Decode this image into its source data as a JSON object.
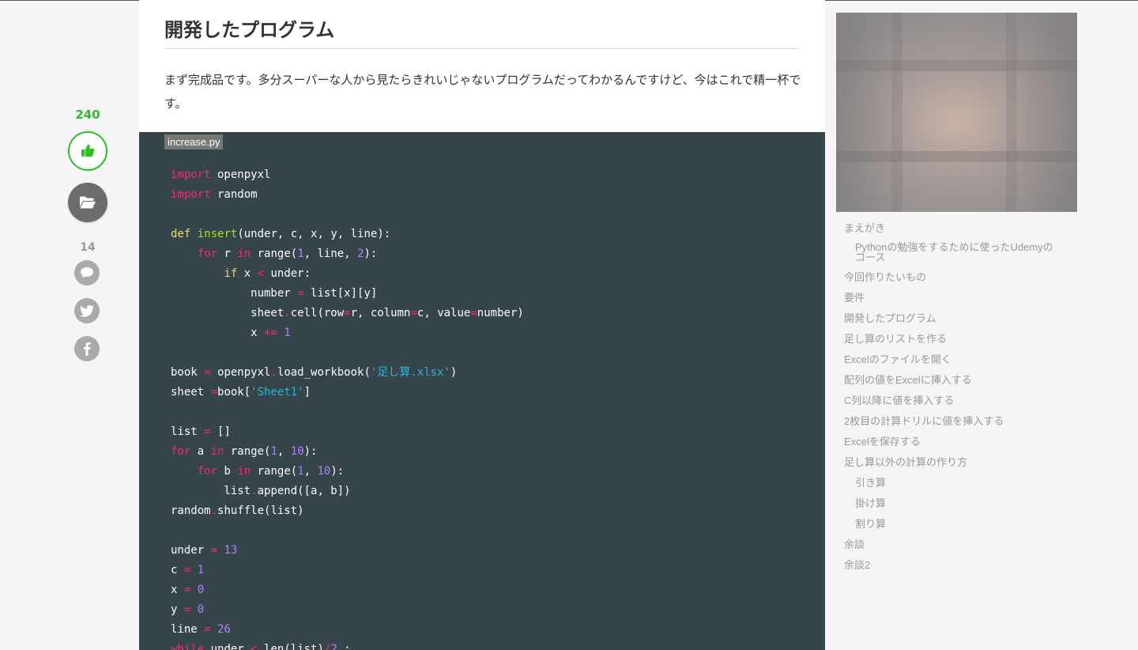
{
  "rail": {
    "like_count": "240",
    "comment_count": "14"
  },
  "icons": {
    "like": "thumbs-up-icon",
    "stock": "folder-open-icon",
    "comment": "speech-bubble-icon",
    "twitter": "twitter-bird-icon",
    "facebook": "facebook-f-icon"
  },
  "colors": {
    "like_green": "#2bc120",
    "code_background": "#364549",
    "keyword": "#f92672",
    "def_keyword": "#e6db74",
    "function_name": "#a6e22e",
    "number": "#ae81ff",
    "string": "#2bb3d4",
    "toc_text": "#999999"
  },
  "article": {
    "heading": "開発したプログラム",
    "paragraph": "まず完成品です。多分スーパーな人から見たらきれいじゃないプログラムだってわかるんですけど、今はこれで精一杯です。",
    "code_filename": "increase.py",
    "code_lines": [
      [
        [
          "kw",
          "import"
        ],
        [
          "txt",
          " openpyxl"
        ]
      ],
      [
        [
          "kw",
          "import"
        ],
        [
          "txt",
          " random"
        ]
      ],
      [],
      [
        [
          "def",
          "def"
        ],
        [
          "txt",
          " "
        ],
        [
          "fn",
          "insert"
        ],
        [
          "txt",
          "(under, c, x, y, line):"
        ]
      ],
      [
        [
          "txt",
          "    "
        ],
        [
          "kw",
          "for"
        ],
        [
          "txt",
          " r "
        ],
        [
          "kw",
          "in"
        ],
        [
          "txt",
          " range("
        ],
        [
          "num",
          "1"
        ],
        [
          "txt",
          ", line, "
        ],
        [
          "num",
          "2"
        ],
        [
          "txt",
          "):"
        ]
      ],
      [
        [
          "txt",
          "        "
        ],
        [
          "def",
          "if"
        ],
        [
          "txt",
          " x "
        ],
        [
          "op",
          "<"
        ],
        [
          "txt",
          " under:"
        ]
      ],
      [
        [
          "txt",
          "            number "
        ],
        [
          "op",
          "="
        ],
        [
          "txt",
          " list[x][y]"
        ]
      ],
      [
        [
          "txt",
          "            sheet"
        ],
        [
          "op",
          "."
        ],
        [
          "txt",
          "cell(row"
        ],
        [
          "op",
          "="
        ],
        [
          "txt",
          "r, column"
        ],
        [
          "op",
          "="
        ],
        [
          "txt",
          "c, value"
        ],
        [
          "op",
          "="
        ],
        [
          "txt",
          "number)"
        ]
      ],
      [
        [
          "txt",
          "            x "
        ],
        [
          "op",
          "+="
        ],
        [
          "txt",
          " "
        ],
        [
          "num",
          "1"
        ]
      ],
      [],
      [
        [
          "txt",
          "book "
        ],
        [
          "op",
          "="
        ],
        [
          "txt",
          " openpyxl"
        ],
        [
          "op",
          "."
        ],
        [
          "txt",
          "load_workbook("
        ],
        [
          "str",
          "'足し算.xlsx'"
        ],
        [
          "txt",
          ")"
        ]
      ],
      [
        [
          "txt",
          "sheet "
        ],
        [
          "op",
          "="
        ],
        [
          "txt",
          "book["
        ],
        [
          "str",
          "'Sheet1'"
        ],
        [
          "txt",
          "]"
        ]
      ],
      [],
      [
        [
          "txt",
          "list "
        ],
        [
          "op",
          "="
        ],
        [
          "txt",
          " []"
        ]
      ],
      [
        [
          "kw",
          "for"
        ],
        [
          "txt",
          " a "
        ],
        [
          "kw",
          "in"
        ],
        [
          "txt",
          " range("
        ],
        [
          "num",
          "1"
        ],
        [
          "txt",
          ", "
        ],
        [
          "num",
          "10"
        ],
        [
          "txt",
          "):"
        ]
      ],
      [
        [
          "txt",
          "    "
        ],
        [
          "kw",
          "for"
        ],
        [
          "txt",
          " b "
        ],
        [
          "kw",
          "in"
        ],
        [
          "txt",
          " range("
        ],
        [
          "num",
          "1"
        ],
        [
          "txt",
          ", "
        ],
        [
          "num",
          "10"
        ],
        [
          "txt",
          "):"
        ]
      ],
      [
        [
          "txt",
          "        list"
        ],
        [
          "op",
          "."
        ],
        [
          "txt",
          "append([a, b])"
        ]
      ],
      [
        [
          "txt",
          "random"
        ],
        [
          "op",
          "."
        ],
        [
          "txt",
          "shuffle(list)"
        ]
      ],
      [],
      [
        [
          "txt",
          "under "
        ],
        [
          "op",
          "="
        ],
        [
          "txt",
          " "
        ],
        [
          "num",
          "13"
        ]
      ],
      [
        [
          "txt",
          "c "
        ],
        [
          "op",
          "="
        ],
        [
          "txt",
          " "
        ],
        [
          "num",
          "1"
        ]
      ],
      [
        [
          "txt",
          "x "
        ],
        [
          "op",
          "="
        ],
        [
          "txt",
          " "
        ],
        [
          "num",
          "0"
        ]
      ],
      [
        [
          "txt",
          "y "
        ],
        [
          "op",
          "="
        ],
        [
          "txt",
          " "
        ],
        [
          "num",
          "0"
        ]
      ],
      [
        [
          "txt",
          "line "
        ],
        [
          "op",
          "="
        ],
        [
          "txt",
          " "
        ],
        [
          "num",
          "26"
        ]
      ],
      [
        [
          "kw",
          "while"
        ],
        [
          "txt",
          " under "
        ],
        [
          "op",
          "<"
        ],
        [
          "txt",
          " len(list)"
        ],
        [
          "op",
          "/"
        ],
        [
          "num",
          "2"
        ],
        [
          "txt",
          " :"
        ]
      ]
    ]
  },
  "sidebar": {
    "toc": [
      {
        "label": "まえがき",
        "level": 1
      },
      {
        "label": "Pythonの勉強をするために使ったUdemyのコース",
        "level": 2
      },
      {
        "label": "今回作りたいもの",
        "level": 1
      },
      {
        "label": "要件",
        "level": 1
      },
      {
        "label": "開発したプログラム",
        "level": 1
      },
      {
        "label": "足し算のリストを作る",
        "level": 1
      },
      {
        "label": "Excelのファイルを開く",
        "level": 1
      },
      {
        "label": "配列の値をExcelに挿入する",
        "level": 1
      },
      {
        "label": "C列以降に値を挿入する",
        "level": 1
      },
      {
        "label": "2枚目の計算ドリルに値を挿入する",
        "level": 1
      },
      {
        "label": "Excelを保存する",
        "level": 1
      },
      {
        "label": "足し算以外の計算の作り方",
        "level": 1
      },
      {
        "label": "引き算",
        "level": 2
      },
      {
        "label": "掛け算",
        "level": 2
      },
      {
        "label": "割り算",
        "level": 2
      },
      {
        "label": "余談",
        "level": 1
      },
      {
        "label": "余談2",
        "level": 1
      }
    ]
  }
}
